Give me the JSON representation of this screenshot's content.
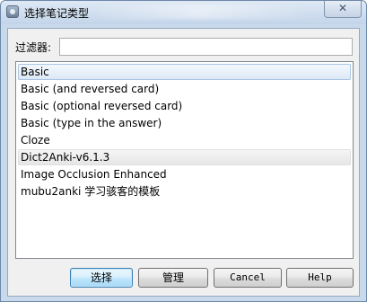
{
  "window": {
    "title": "选择笔记类型",
    "close_glyph": "✕"
  },
  "filter": {
    "label": "过滤器:",
    "value": "",
    "placeholder": ""
  },
  "note_types": [
    "Basic",
    "Basic (and reversed card)",
    "Basic (optional reversed card)",
    "Basic (type in the answer)",
    "Cloze",
    "Dict2Anki-v6.1.3",
    "Image Occlusion Enhanced",
    "mubu2anki 学习骇客的模板"
  ],
  "selected_item": "Basic",
  "buttons": {
    "choose": "选择",
    "manage": "管理",
    "cancel": "Cancel",
    "help": "Help"
  },
  "colors": {
    "selection_fill": "#dde9f6",
    "selection_border": "#a8c4e4",
    "default_button_border": "#3c7fb1",
    "dialog_face": "#f0f0f0"
  }
}
